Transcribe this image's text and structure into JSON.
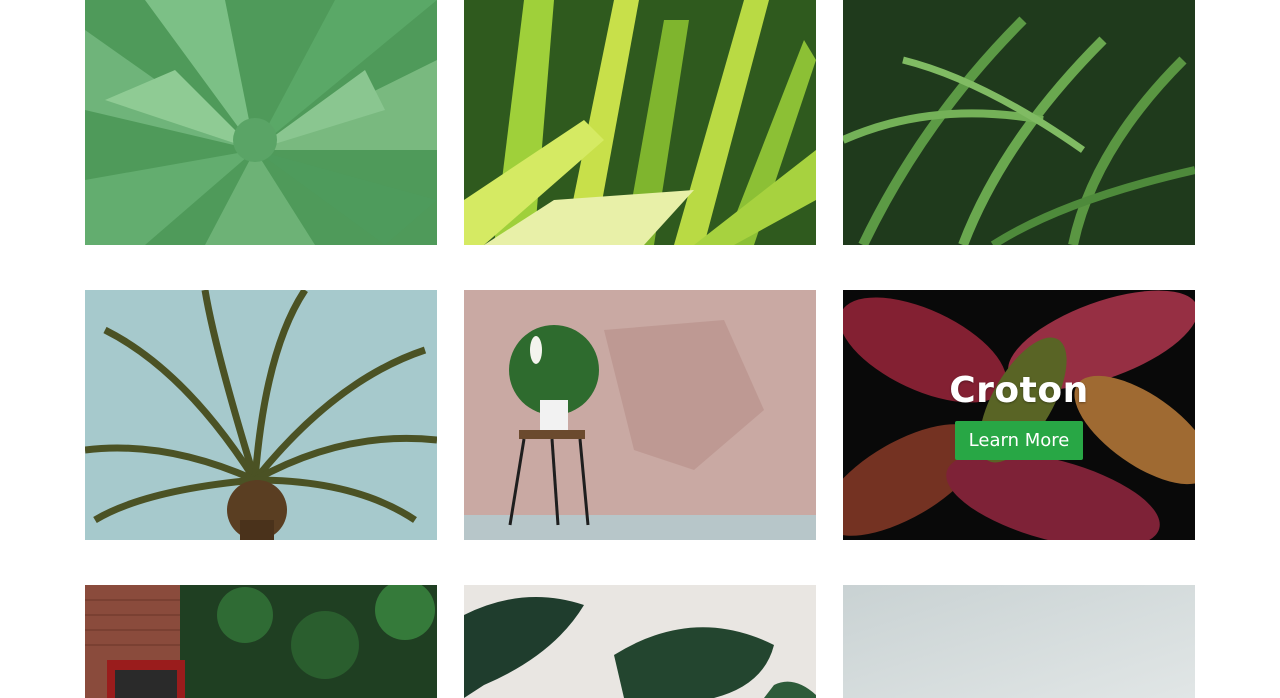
{
  "colors": {
    "background": "#ffffff",
    "button": "#28a745",
    "button_text": "#ffffff",
    "overlay_title": "#ffffff"
  },
  "gallery": {
    "tiles": [
      {
        "image": "aloe-plant-photo"
      },
      {
        "image": "dracaena-plant-photo"
      },
      {
        "image": "fern-plant-photo"
      },
      {
        "image": "palm-tree-photo"
      },
      {
        "image": "peace-lily-on-stool-photo"
      },
      {
        "image": "croton-plant-photo",
        "hover": {
          "title": "Croton",
          "button_label": "Learn More"
        }
      },
      {
        "image": "ivy-brick-wall-photo"
      },
      {
        "image": "monstera-plant-photo"
      },
      {
        "image": "blurred-plant-photo"
      }
    ]
  }
}
